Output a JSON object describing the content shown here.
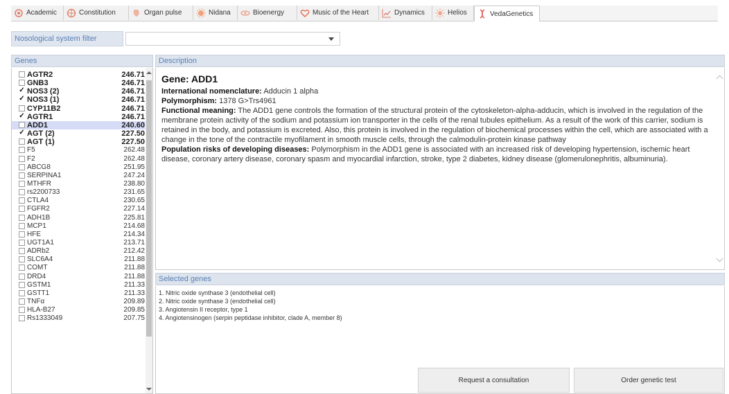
{
  "tabs": [
    {
      "label": "Academic",
      "icon": "academic-icon"
    },
    {
      "label": "Constitution",
      "icon": "constitution-icon"
    },
    {
      "label": "Organ pulse",
      "icon": "organ-pulse-icon"
    },
    {
      "label": "Nidana",
      "icon": "nidana-icon"
    },
    {
      "label": "Bioenergy",
      "icon": "bioenergy-icon"
    },
    {
      "label": "Music of the Heart",
      "icon": "heart-icon"
    },
    {
      "label": "Dynamics",
      "icon": "dynamics-chart-icon"
    },
    {
      "label": "Helios",
      "icon": "helios-icon"
    },
    {
      "label": "VedaGenetics",
      "icon": "dna-icon",
      "active": true
    }
  ],
  "filter": {
    "label": "Nosological system filter",
    "value": ""
  },
  "genes_panel": {
    "title": "Genes"
  },
  "genes": [
    {
      "name": "AGTR2",
      "value": "246.71",
      "checked": false,
      "bold": true
    },
    {
      "name": "GNB3",
      "value": "246.71",
      "checked": false,
      "bold": true
    },
    {
      "name": "NOS3 (2)",
      "value": "246.71",
      "checked": true,
      "bold": true
    },
    {
      "name": "NOS3 (1)",
      "value": "246.71",
      "checked": true,
      "bold": true
    },
    {
      "name": "CYP11B2",
      "value": "246.71",
      "checked": false,
      "bold": true
    },
    {
      "name": "AGTR1",
      "value": "246.71",
      "checked": true,
      "bold": true
    },
    {
      "name": "ADD1",
      "value": "240.60",
      "checked": false,
      "bold": true,
      "selected": true
    },
    {
      "name": "AGT (2)",
      "value": "227.50",
      "checked": true,
      "bold": true
    },
    {
      "name": "AGT (1)",
      "value": "227.50",
      "checked": false,
      "bold": true
    },
    {
      "name": "F5",
      "value": "262.48",
      "checked": false,
      "bold": false
    },
    {
      "name": "F2",
      "value": "262.48",
      "checked": false,
      "bold": false
    },
    {
      "name": "ABCG8",
      "value": "251.95",
      "checked": false,
      "bold": false
    },
    {
      "name": "SERPINA1",
      "value": "247.24",
      "checked": false,
      "bold": false
    },
    {
      "name": "MTHFR",
      "value": "238.80",
      "checked": false,
      "bold": false
    },
    {
      "name": "rs2200733",
      "value": "231.65",
      "checked": false,
      "bold": false
    },
    {
      "name": "CTLA4",
      "value": "230.65",
      "checked": false,
      "bold": false
    },
    {
      "name": "FGFR2",
      "value": "227.14",
      "checked": false,
      "bold": false
    },
    {
      "name": "ADH1B",
      "value": "225.81",
      "checked": false,
      "bold": false
    },
    {
      "name": "MCP1",
      "value": "214.68",
      "checked": false,
      "bold": false
    },
    {
      "name": "HFE",
      "value": "214.34",
      "checked": false,
      "bold": false
    },
    {
      "name": "UGT1A1",
      "value": "213.71",
      "checked": false,
      "bold": false
    },
    {
      "name": "ADRb2",
      "value": "212.42",
      "checked": false,
      "bold": false
    },
    {
      "name": "SLC6A4",
      "value": "211.88",
      "checked": false,
      "bold": false
    },
    {
      "name": "COMT",
      "value": "211.88",
      "checked": false,
      "bold": false
    },
    {
      "name": "DRD4",
      "value": "211.88",
      "checked": false,
      "bold": false
    },
    {
      "name": "GSTM1",
      "value": "211.33",
      "checked": false,
      "bold": false
    },
    {
      "name": "GSTT1",
      "value": "211.33",
      "checked": false,
      "bold": false
    },
    {
      "name": "TNFα",
      "value": "209.89",
      "checked": false,
      "bold": false
    },
    {
      "name": "HLA-B27",
      "value": "209.85",
      "checked": false,
      "bold": false
    },
    {
      "name": "Rs1333049",
      "value": "207.75",
      "checked": false,
      "bold": false
    }
  ],
  "description_panel": {
    "title": "Description",
    "gene_title": "Gene: ADD1",
    "nomenclature_label": "International nomenclature:",
    "nomenclature": "Adducin 1 alpha",
    "polymorphism_label": "Polymorphism:",
    "polymorphism": "1378 G>Trs4961",
    "functional_label": "Functional meaning:",
    "functional": "The ADD1 gene controls the formation of the structural protein of the cytoskeleton-alpha-adducin, which is involved in the regulation of the membrane protein activity of the sodium and potassium ion transporter in the cells of the renal tubules epithelium. As a result of the work of this carrier, sodium is retained in the body, and potassium is excreted. Also, this protein is involved in the regulation of biochemical processes within the cell, which are associated with a change in the tone of the contractile myofilament in smooth muscle cells, through the calmodulin-protein kinase pathway",
    "risks_label": "Population risks of developing diseases:",
    "risks": "Polymorphism in the ADD1 gene is associated with an increased risk of developing hypertension, ischemic heart disease, coronary artery disease, coronary spasm and myocardial infarction, stroke, type 2 diabetes, kidney disease (glomerulonephritis, albuminuria)."
  },
  "selected_panel": {
    "title": "Selected genes",
    "items": [
      "1. Nitric oxide synthase 3 (endothelial cell)",
      "2. Nitric oxide synthase 3 (endothelial cell)",
      "3. Angiotensin II receptor, type 1",
      "4. Angiotensinogen (serpin peptidase inhibitor, clade A, member 8)"
    ]
  },
  "buttons": {
    "consultation": "Request a consultation",
    "order": "Order genetic test"
  }
}
